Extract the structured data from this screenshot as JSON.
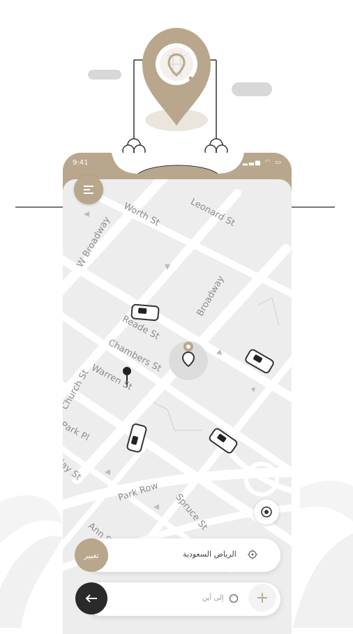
{
  "status_bar": {
    "time": "9:41",
    "icons": "▂▃▅ ◠ ▭"
  },
  "map": {
    "streets": [
      "Worth St",
      "Leonard St",
      "W Broadway",
      "Broadway",
      "Reade St",
      "Chambers St",
      "Warren St",
      "Church St",
      "Park Pl",
      "Park Row",
      "Spruce St",
      "Ann St",
      "lay St"
    ]
  },
  "trip": {
    "change_label": "تغيير",
    "from_text": "الرياض السعودية",
    "to_placeholder": "إلى أين"
  },
  "add_label": "+",
  "colors": {
    "accent": "#b8a78c",
    "dark": "#2a2a2a",
    "map_bg": "#ededed",
    "road": "#ffffff"
  },
  "icons": [
    "menu-icon",
    "pin-icon",
    "locate-icon",
    "target-icon",
    "clock-icon",
    "arrow-left-icon",
    "plus-icon"
  ]
}
